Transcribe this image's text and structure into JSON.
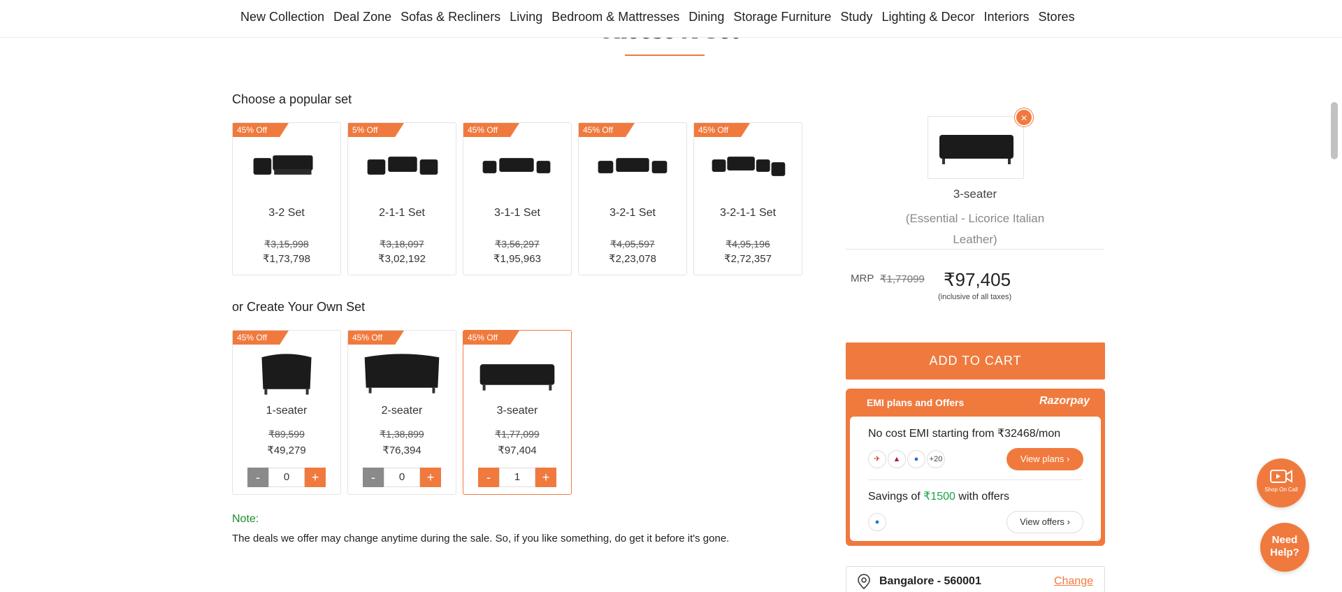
{
  "nav": {
    "items": [
      "New Collection",
      "Deal Zone",
      "Sofas & Recliners",
      "Living",
      "Bedroom & Mattresses",
      "Dining",
      "Storage Furniture",
      "Study",
      "Lighting & Decor",
      "Interiors",
      "Stores"
    ]
  },
  "page": {
    "section_title": "Choose A Set",
    "popular_heading": "Choose a popular set",
    "create_heading": "or Create Your Own Set"
  },
  "popular_sets": [
    {
      "discount": "45% Off",
      "name": "3-2 Set",
      "mrp": "₹3,15,998",
      "price": "₹1,73,798"
    },
    {
      "discount": "5% Off",
      "name": "2-1-1 Set",
      "mrp": "₹3,18,097",
      "price": "₹3,02,192"
    },
    {
      "discount": "45% Off",
      "name": "3-1-1 Set",
      "mrp": "₹3,56,297",
      "price": "₹1,95,963"
    },
    {
      "discount": "45% Off",
      "name": "3-2-1 Set",
      "mrp": "₹4,05,597",
      "price": "₹2,23,078"
    },
    {
      "discount": "45% Off",
      "name": "3-2-1-1 Set",
      "mrp": "₹4,95,196",
      "price": "₹2,72,357"
    }
  ],
  "custom_sets": [
    {
      "discount": "45% Off",
      "name": "1-seater",
      "mrp": "₹89,599",
      "price": "₹49,279",
      "qty": "0"
    },
    {
      "discount": "45% Off",
      "name": "2-seater",
      "mrp": "₹1,38,899",
      "price": "₹76,394",
      "qty": "0"
    },
    {
      "discount": "45% Off",
      "name": "3-seater",
      "mrp": "₹1,77,099",
      "price": "₹97,404",
      "qty": "1"
    }
  ],
  "qty_controls": {
    "minus": "-",
    "plus": "+"
  },
  "note": {
    "label": "Note:",
    "text": "The deals we offer may change anytime during the sale. So, if you like something, do get it before it's gone."
  },
  "summary": {
    "close": "×",
    "item_name": "3-seater",
    "variant": "(Essential - Licorice Italian Leather)",
    "mrp_label": "MRP",
    "mrp": "₹1,77099",
    "price": "₹97,405",
    "tax_note": "(inclusive of all taxes)",
    "add_to_cart": "ADD TO CART"
  },
  "emi": {
    "heading": "EMI plans and Offers",
    "provider": "Razorpay",
    "line1": "No cost EMI starting from ₹32468/mon",
    "more_banks": "+20",
    "view_plans": "View plans",
    "savings_prefix": "Savings of ",
    "savings_amount": "₹1500",
    "savings_suffix": " with offers",
    "view_offers": "View offers"
  },
  "location": {
    "text": "Bangalore - 560001",
    "change": "Change"
  },
  "floating": {
    "shop_call": "Shop On Call",
    "need_help": "Need Help?"
  },
  "colors": {
    "accent": "#f07a3e",
    "green": "#1aa34a"
  }
}
